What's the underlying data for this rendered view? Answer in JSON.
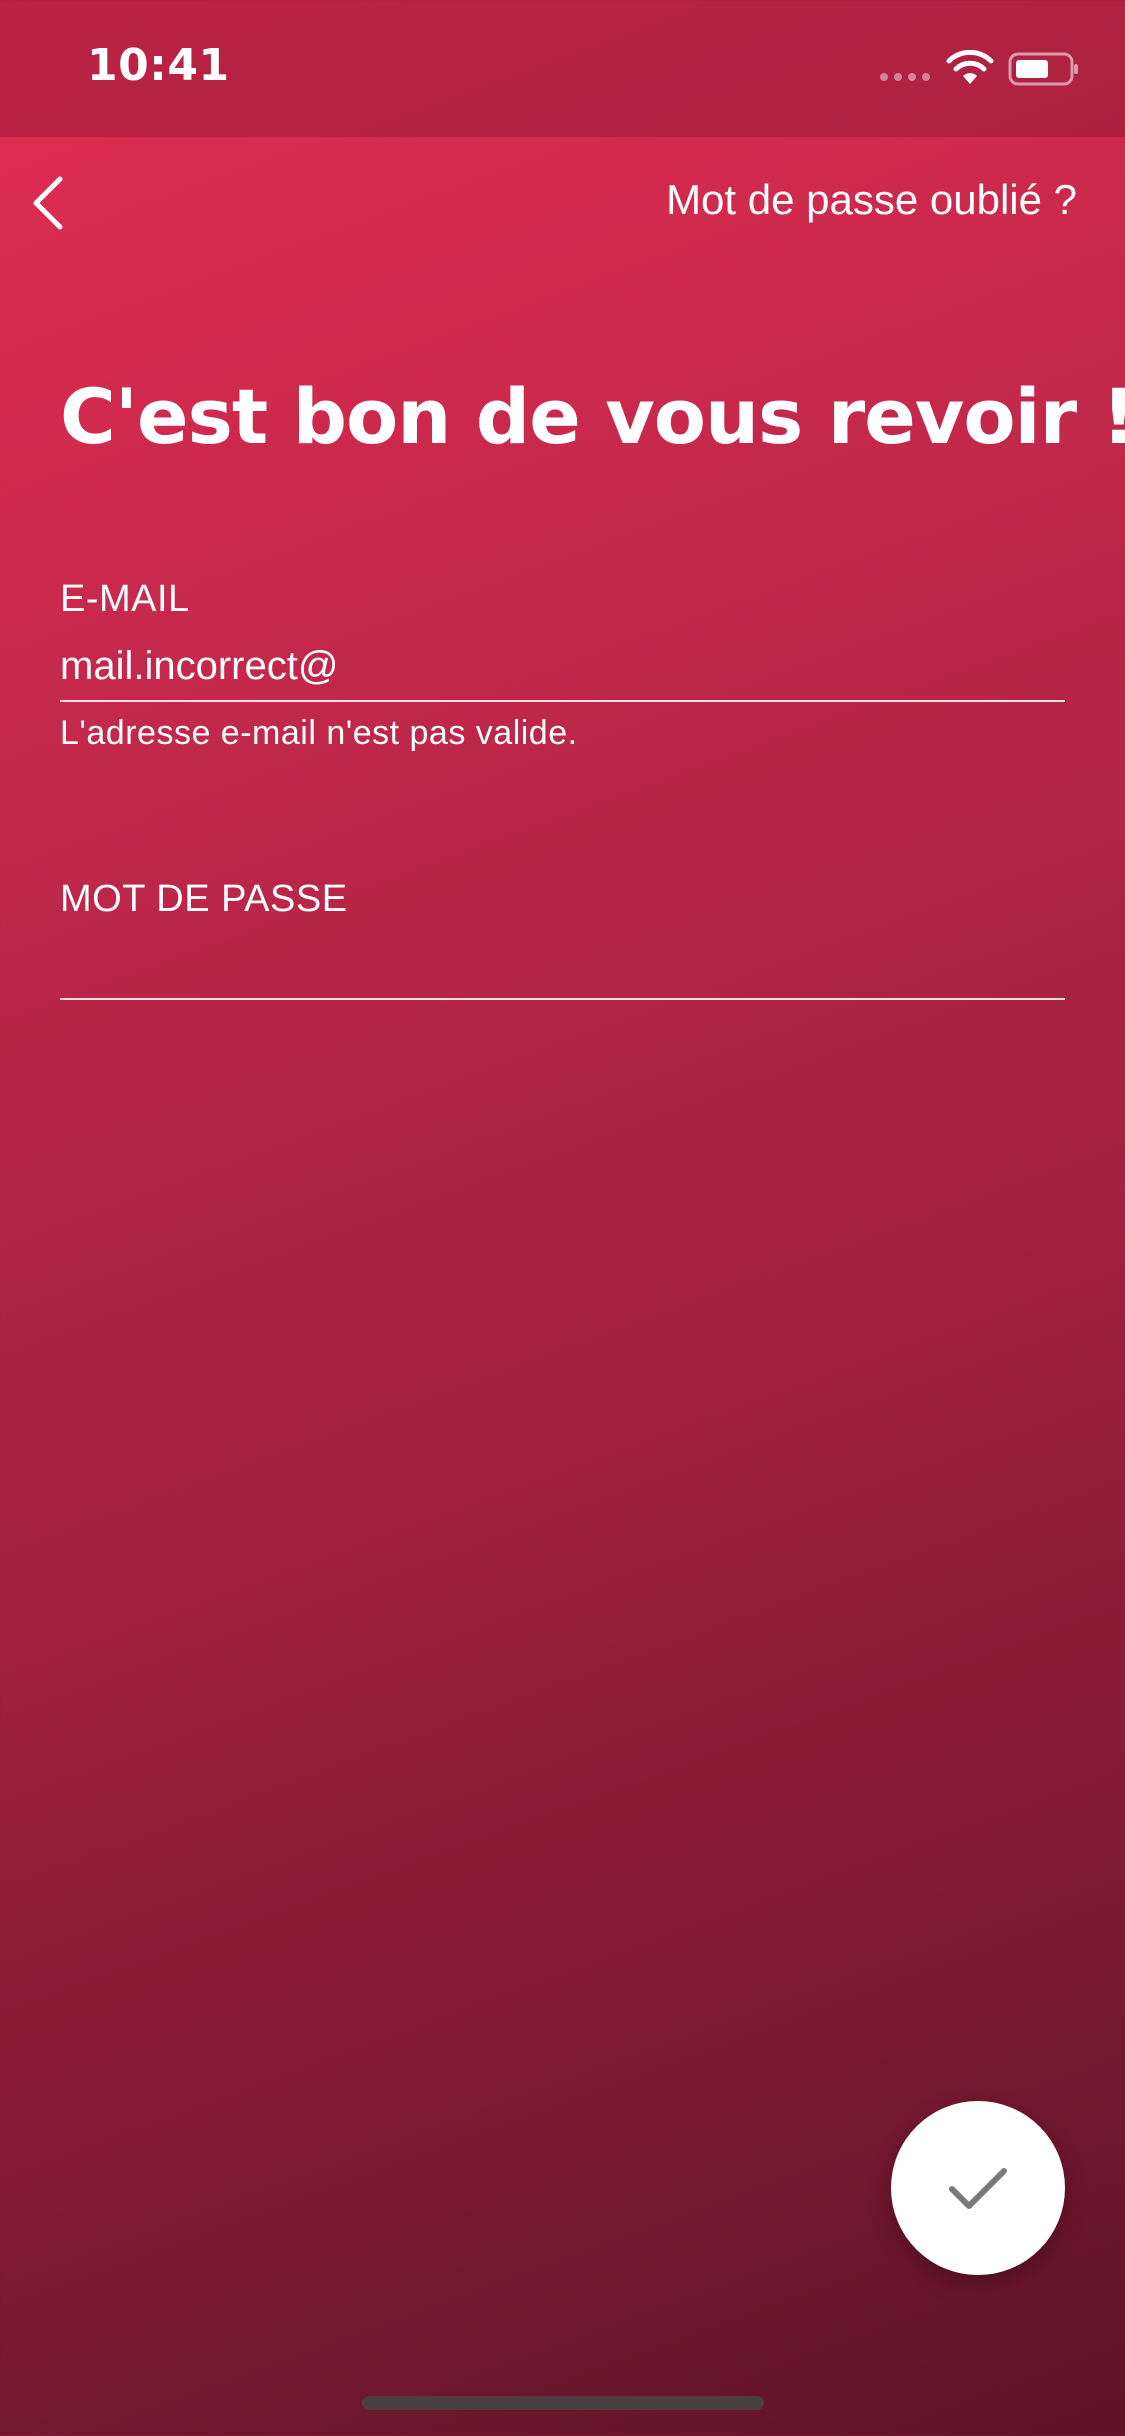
{
  "status_bar": {
    "time": "10:41"
  },
  "header": {
    "back_icon": "chevron-left-icon",
    "forgot_password_label": "Mot de passe oublié ?"
  },
  "title": "C'est bon de vous revoir !",
  "form": {
    "email": {
      "label": "E-MAIL",
      "value": "mail.incorrect@",
      "error": "L'adresse e-mail n'est pas valide."
    },
    "password": {
      "label": "MOT DE PASSE",
      "value": ""
    }
  },
  "submit": {
    "icon": "checkmark-icon",
    "icon_color": "#7a7a7a"
  },
  "colors": {
    "gradient_start": "#e52c52",
    "gradient_end": "#5f1229",
    "text": "#ffffff"
  }
}
